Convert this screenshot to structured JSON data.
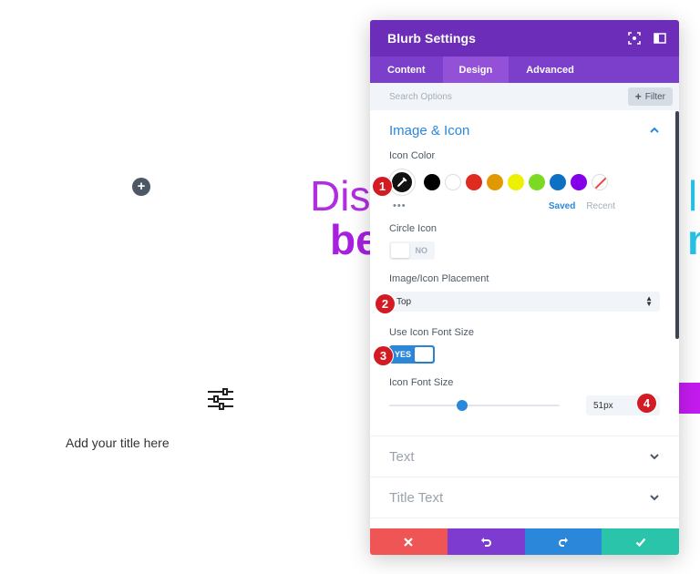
{
  "background": {
    "heading_line1": "Dis",
    "heading_line1_tail": "ll",
    "heading_line2": "be",
    "heading_line2_tail": "nt",
    "title_placeholder": "Add your title here"
  },
  "panel": {
    "title": "Blurb Settings",
    "tabs": [
      {
        "label": "Content",
        "active": false
      },
      {
        "label": "Design",
        "active": true
      },
      {
        "label": "Advanced",
        "active": false
      }
    ],
    "search_placeholder": "Search Options",
    "filter_label": "Filter"
  },
  "image_icon": {
    "title": "Image & Icon",
    "icon_color_label": "Icon Color",
    "swatches": [
      "#000000",
      "#ffffff",
      "#e02b20",
      "#e09900",
      "#edf000",
      "#7cda24",
      "#0c71c3",
      "#8300e9"
    ],
    "saved_label": "Saved",
    "recent_label": "Recent",
    "circle_icon_label": "Circle Icon",
    "circle_icon_value": "NO",
    "placement_label": "Image/Icon Placement",
    "placement_value": "Top",
    "use_font_size_label": "Use Icon Font Size",
    "use_font_size_value": "YES",
    "font_size_label": "Icon Font Size",
    "font_size_value": "51px",
    "font_size_slider_fraction": 0.42
  },
  "sections": {
    "text": "Text",
    "title_text": "Title Text"
  },
  "badges": [
    "1",
    "2",
    "3",
    "4"
  ],
  "colors": {
    "header": "#6c2eb9",
    "tabs": "#7b3fcc",
    "accent": "#2b87da",
    "cancel": "#ef5555",
    "undo": "#7e3bd0",
    "redo": "#2b87da",
    "save": "#29c4a9",
    "badge": "#d21b22"
  }
}
